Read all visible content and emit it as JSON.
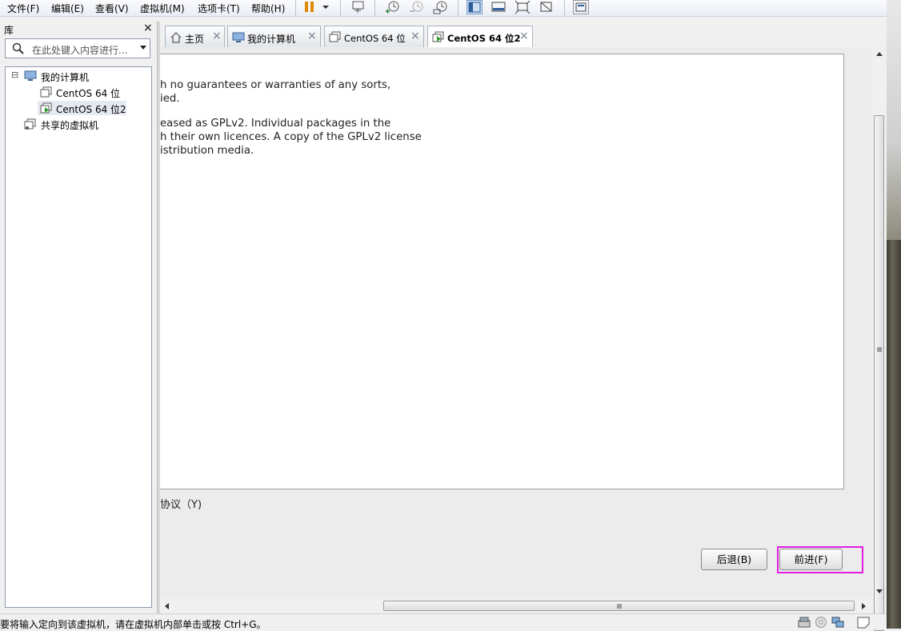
{
  "menu": {
    "file": "文件(F)",
    "edit": "编辑(E)",
    "view": "查看(V)",
    "vm": "虚拟机(M)",
    "tabs": "选项卡(T)",
    "help": "帮助(H)"
  },
  "toolbar": {
    "icons": [
      "pause-icon",
      "dropdown-arrow-icon",
      "send-ctrl-alt-del-icon",
      "snapshot-take-icon",
      "snapshot-revert-icon",
      "snapshot-manager-icon",
      "library-view-icon",
      "console-view-icon",
      "fullscreen-icon",
      "unity-icon",
      "thumbnail-view-icon"
    ],
    "accent": "#e08a00"
  },
  "library": {
    "title": "库",
    "close": "×",
    "search_placeholder": "在此处键入内容进行...",
    "tree": [
      {
        "label": "我的计算机",
        "expander": "⊟"
      },
      {
        "label": "CentOS 64 位"
      },
      {
        "label": "CentOS 64 位2",
        "selected": true
      },
      {
        "label": "共享的虚拟机"
      }
    ]
  },
  "tabs": [
    {
      "label": "主页",
      "close": "×"
    },
    {
      "label": "我的计算机",
      "close": "×"
    },
    {
      "label": "CentOS 64 位",
      "close": "×"
    },
    {
      "label": "CentOS 64 位2",
      "close": "×",
      "active": true
    }
  ],
  "license": {
    "lines": [
      "h no guarantees or warranties of any sorts,",
      "ied.",
      "eased as GPLv2. Individual packages in the",
      "h their own licences. A copy of the GPLv2 license",
      "istribution media."
    ],
    "accept_label": "协议（Y)"
  },
  "buttons": {
    "back": "后退(B)",
    "forward": "前进(F)",
    "highlight_color": "#e21ee2"
  },
  "status": {
    "text": "要将输入定向到该虚拟机，请在虚拟机内部单击或按 Ctrl+G。",
    "icons": [
      "hard-disk-icon",
      "cd-icon",
      "network-icon",
      "message-icon"
    ]
  }
}
